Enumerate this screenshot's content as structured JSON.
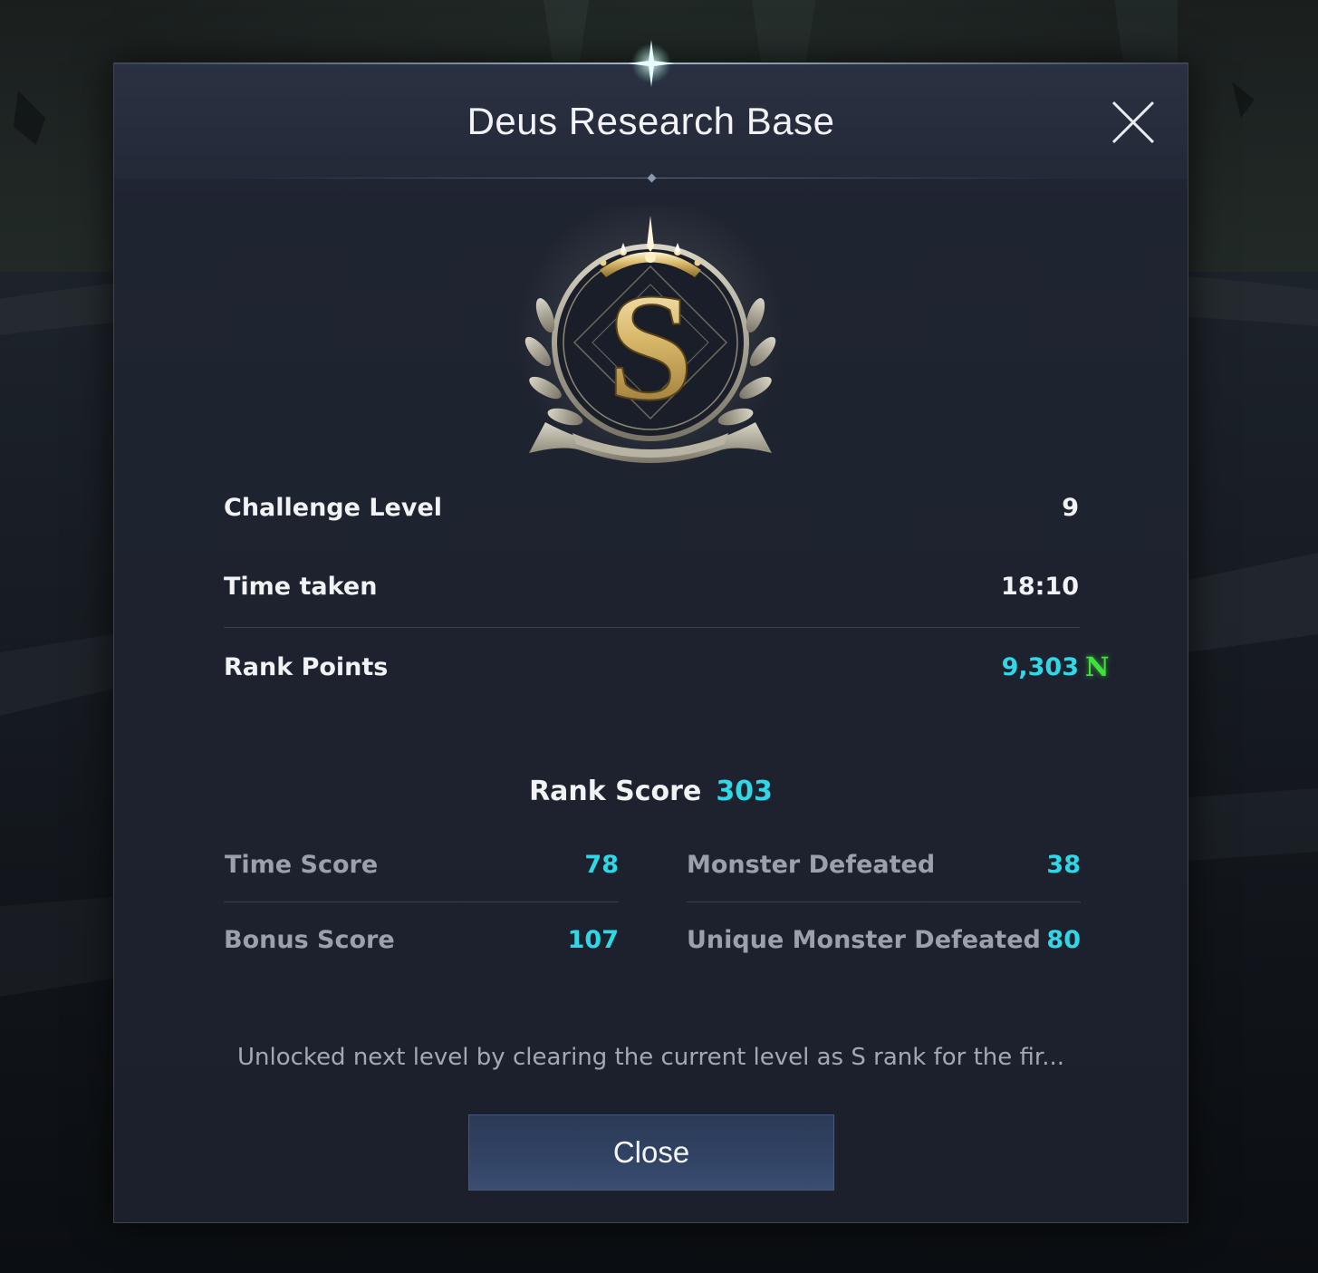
{
  "dialog": {
    "title": "Deus Research Base",
    "close_icon": "close-icon",
    "badge_icon": "s-rank-emblem-icon",
    "badge_letter": "S"
  },
  "results": {
    "challenge_level": {
      "label": "Challenge Level",
      "value": "9"
    },
    "time_taken": {
      "label": "Time taken",
      "value": "18:10"
    },
    "rank_points": {
      "label": "Rank Points",
      "value": "9,303",
      "badge": "N"
    }
  },
  "rank_score": {
    "label": "Rank Score",
    "value": "303",
    "breakdown": {
      "time_score": {
        "label": "Time Score",
        "value": "78"
      },
      "monster_defeated": {
        "label": "Monster Defeated",
        "value": "38"
      },
      "bonus_score": {
        "label": "Bonus Score",
        "value": "107"
      },
      "unique_monster_defeated": {
        "label": "Unique Monster Defeated",
        "value": "80"
      }
    }
  },
  "note": "Unlocked next level by clearing the current level as S rank for the fir...",
  "footer": {
    "close_label": "Close"
  },
  "colors": {
    "accent": "#2fd8e6",
    "new_badge": "#3fe23a",
    "panel": "#1f2431",
    "button": "#314264"
  }
}
